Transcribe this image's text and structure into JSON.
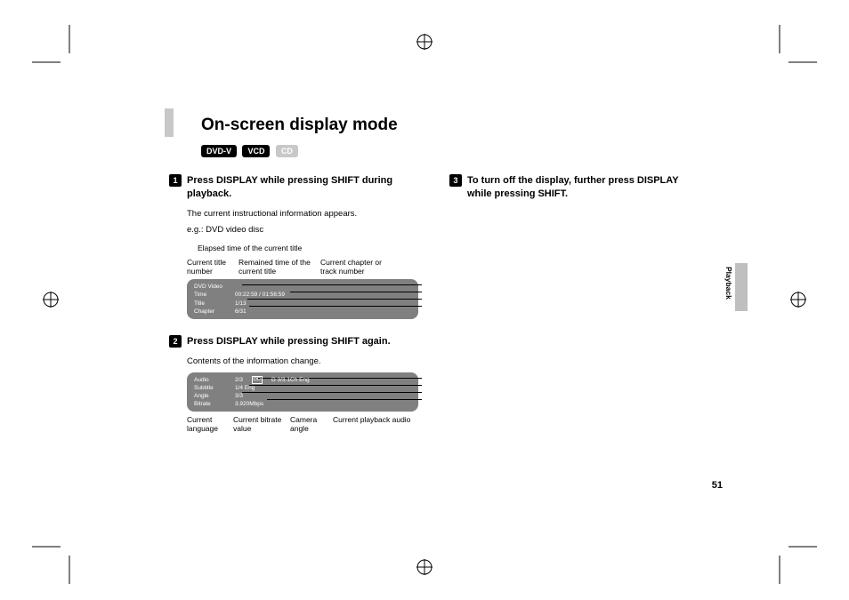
{
  "title": "On-screen display mode",
  "badges": {
    "a": "DVD-V",
    "b": "VCD",
    "c": "CD"
  },
  "step1": {
    "num": "1",
    "heading": "Press DISPLAY while pressing SHIFT during playback.",
    "body": "The current instructional information appears.",
    "eg": "e.g.: DVD video disc",
    "callouts": {
      "elapsed": "Elapsed time of the current title",
      "title_num": "Current title number",
      "remain": "Remained time of the current title",
      "chapter": "Current chapter or track number"
    },
    "osd": {
      "l0": "DVD Video",
      "l1": "Time",
      "v1": "00:22:59 / 01:56:59",
      "l2": "Title",
      "v2": "1/13",
      "l3": "Chapter",
      "v3": "6/31"
    }
  },
  "step2": {
    "num": "2",
    "heading": "Press DISPLAY while pressing SHIFT again.",
    "body": "Contents of the information change.",
    "osd": {
      "l1": "Audio",
      "v1": "2/3",
      "v1b": "D 3/3.1Ch Eng",
      "l2": "Subtitle",
      "v2": "1/4 Eng",
      "l3": "Angle",
      "v3": "3/3",
      "l4": "Bitrate",
      "v4": "3.920Mbps"
    },
    "callouts": {
      "lang": "Current language",
      "bitrate": "Current bitrate value",
      "angle": "Camera angle",
      "audio": "Current playback audio"
    }
  },
  "step3": {
    "num": "3",
    "heading": "To turn off the display, further press DISPLAY while pressing SHIFT."
  },
  "sidetab": "Playback",
  "pagenum": "51"
}
